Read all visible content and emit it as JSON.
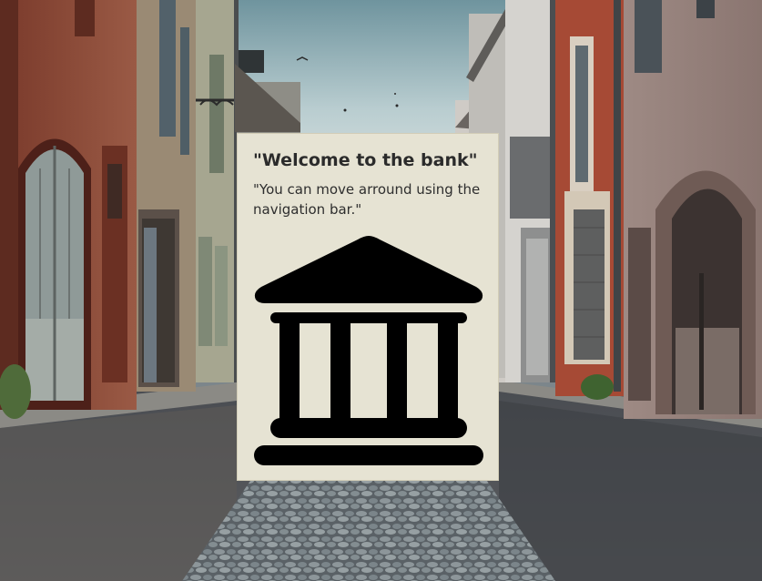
{
  "popup": {
    "title": "\"Welcome to the bank\"",
    "message": "\"You can move arround using the navigation bar.\"",
    "icon": "bank-icon"
  },
  "colors": {
    "card_background": "#e6e3d3",
    "icon": "#000000",
    "text": "#2b2b2b"
  }
}
